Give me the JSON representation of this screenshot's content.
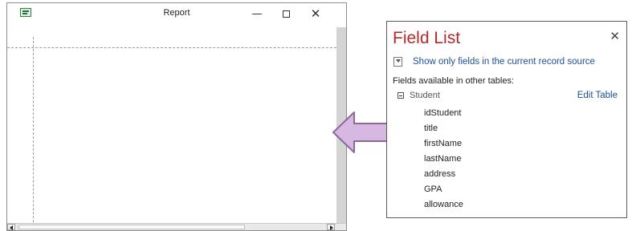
{
  "report_window": {
    "title": "Report",
    "minimize_glyph": "—",
    "close_glyph": "✕"
  },
  "field_list": {
    "title": "Field List",
    "close_glyph": "✕",
    "show_only_label": "Show only fields in the current record source",
    "fields_available_label": "Fields available in other tables:",
    "table": {
      "name": "Student",
      "edit_label": "Edit Table",
      "fields": [
        "idStudent",
        "title",
        "firstName",
        "lastName",
        "address",
        "GPA",
        "allowance"
      ]
    }
  },
  "arrow": {
    "fill": "#d7b8e2",
    "stroke": "#8a6a99"
  },
  "colors": {
    "pane_title": "#b22a2a",
    "link": "#1f4e96"
  }
}
